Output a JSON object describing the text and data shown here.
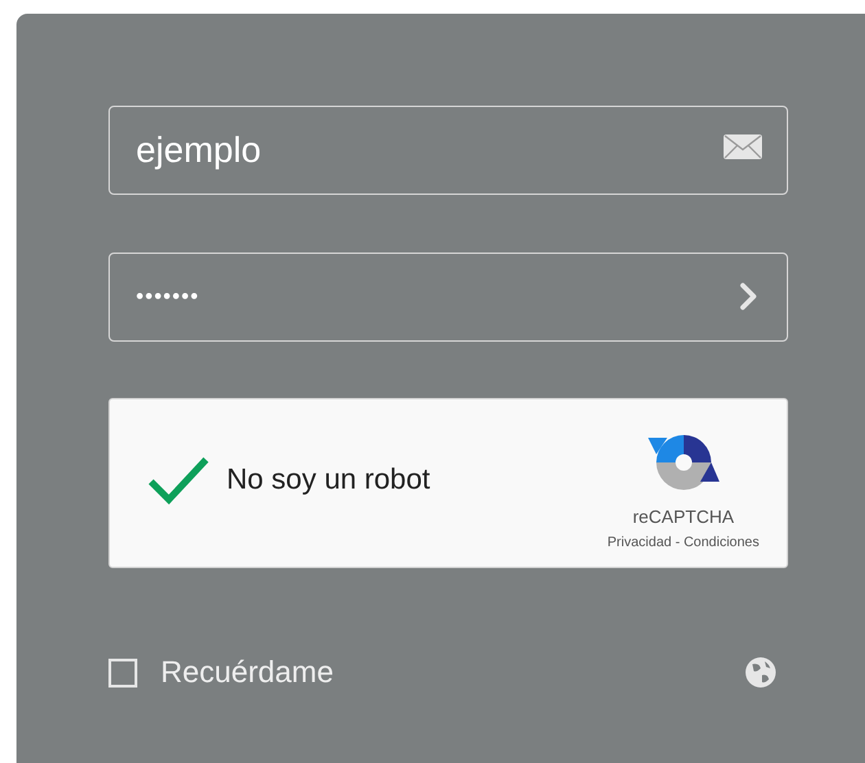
{
  "login": {
    "username": {
      "value": "ejemplo"
    },
    "password": {
      "value": "•••••••"
    },
    "captcha": {
      "checked": true,
      "label": "No soy un robot",
      "brand": "reCAPTCHA",
      "links": "Privacidad - Condiciones"
    },
    "remember": {
      "checked": false,
      "label": "Recuérdame"
    }
  }
}
